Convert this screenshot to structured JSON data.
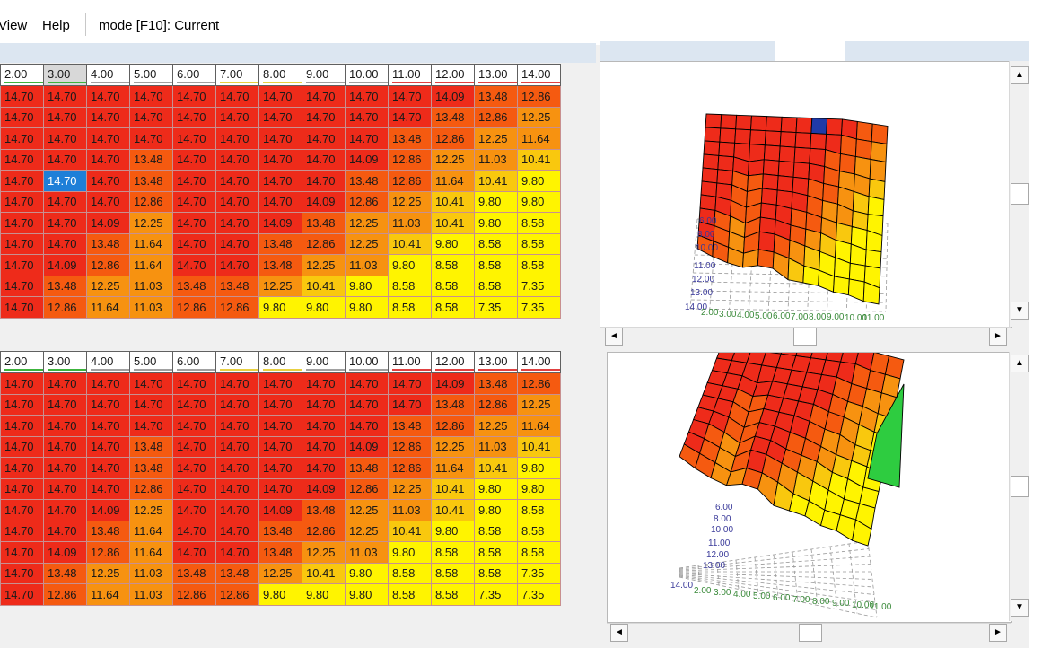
{
  "menu": {
    "view_label": "iew",
    "view_prefix": "V",
    "help_label": "elp",
    "help_prefix": "H",
    "mode_text": "mode [F10]: Current"
  },
  "colors": {
    "red": "#ee2b1a",
    "orange_red": "#f55a10",
    "orange": "#f79210",
    "orange_yellow": "#f9c80e",
    "yellow": "#fff400",
    "selection": "#1e7fd8"
  },
  "table_top": {
    "headers": [
      "2.00",
      "3.00",
      "4.00",
      "5.00",
      "6.00",
      "7.00",
      "8.00",
      "9.00",
      "10.00",
      "11.00",
      "12.00",
      "13.00",
      "14.00"
    ],
    "rows": [
      [
        "14.70",
        "14.70",
        "14.70",
        "14.70",
        "14.70",
        "14.70",
        "14.70",
        "14.70",
        "14.70",
        "14.70",
        "14.09",
        "13.48",
        "12.86"
      ],
      [
        "14.70",
        "14.70",
        "14.70",
        "14.70",
        "14.70",
        "14.70",
        "14.70",
        "14.70",
        "14.70",
        "14.70",
        "13.48",
        "12.86",
        "12.25"
      ],
      [
        "14.70",
        "14.70",
        "14.70",
        "14.70",
        "14.70",
        "14.70",
        "14.70",
        "14.70",
        "14.70",
        "13.48",
        "12.86",
        "12.25",
        "11.64"
      ],
      [
        "14.70",
        "14.70",
        "14.70",
        "13.48",
        "14.70",
        "14.70",
        "14.70",
        "14.70",
        "14.09",
        "12.86",
        "12.25",
        "11.03",
        "10.41"
      ],
      [
        "14.70",
        "14.70",
        "14.70",
        "13.48",
        "14.70",
        "14.70",
        "14.70",
        "14.70",
        "13.48",
        "12.86",
        "11.64",
        "10.41",
        "9.80"
      ],
      [
        "14.70",
        "14.70",
        "14.70",
        "12.86",
        "14.70",
        "14.70",
        "14.70",
        "14.09",
        "12.86",
        "12.25",
        "10.41",
        "9.80",
        "9.80"
      ],
      [
        "14.70",
        "14.70",
        "14.09",
        "12.25",
        "14.70",
        "14.70",
        "14.09",
        "13.48",
        "12.25",
        "11.03",
        "10.41",
        "9.80",
        "8.58"
      ],
      [
        "14.70",
        "14.70",
        "13.48",
        "11.64",
        "14.70",
        "14.70",
        "13.48",
        "12.86",
        "12.25",
        "10.41",
        "9.80",
        "8.58",
        "8.58"
      ],
      [
        "14.70",
        "14.09",
        "12.86",
        "11.64",
        "14.70",
        "14.70",
        "13.48",
        "12.25",
        "11.03",
        "9.80",
        "8.58",
        "8.58",
        "8.58"
      ],
      [
        "14.70",
        "13.48",
        "12.25",
        "11.03",
        "13.48",
        "13.48",
        "12.25",
        "10.41",
        "9.80",
        "8.58",
        "8.58",
        "8.58",
        "7.35"
      ],
      [
        "14.70",
        "12.86",
        "11.64",
        "11.03",
        "12.86",
        "12.86",
        "9.80",
        "9.80",
        "9.80",
        "8.58",
        "8.58",
        "7.35",
        "7.35"
      ]
    ],
    "selected_row": 4,
    "selected_col": 1
  },
  "table_bottom": {
    "headers": [
      "2.00",
      "3.00",
      "4.00",
      "5.00",
      "6.00",
      "7.00",
      "8.00",
      "9.00",
      "10.00",
      "11.00",
      "12.00",
      "13.00",
      "14.00"
    ],
    "rows": [
      [
        "14.70",
        "14.70",
        "14.70",
        "14.70",
        "14.70",
        "14.70",
        "14.70",
        "14.70",
        "14.70",
        "14.70",
        "14.09",
        "13.48",
        "12.86"
      ],
      [
        "14.70",
        "14.70",
        "14.70",
        "14.70",
        "14.70",
        "14.70",
        "14.70",
        "14.70",
        "14.70",
        "14.70",
        "13.48",
        "12.86",
        "12.25"
      ],
      [
        "14.70",
        "14.70",
        "14.70",
        "14.70",
        "14.70",
        "14.70",
        "14.70",
        "14.70",
        "14.70",
        "13.48",
        "12.86",
        "12.25",
        "11.64"
      ],
      [
        "14.70",
        "14.70",
        "14.70",
        "13.48",
        "14.70",
        "14.70",
        "14.70",
        "14.70",
        "14.09",
        "12.86",
        "12.25",
        "11.03",
        "10.41"
      ],
      [
        "14.70",
        "14.70",
        "14.70",
        "13.48",
        "14.70",
        "14.70",
        "14.70",
        "14.70",
        "13.48",
        "12.86",
        "11.64",
        "10.41",
        "9.80"
      ],
      [
        "14.70",
        "14.70",
        "14.70",
        "12.86",
        "14.70",
        "14.70",
        "14.70",
        "14.09",
        "12.86",
        "12.25",
        "10.41",
        "9.80",
        "9.80"
      ],
      [
        "14.70",
        "14.70",
        "14.09",
        "12.25",
        "14.70",
        "14.70",
        "14.09",
        "13.48",
        "12.25",
        "11.03",
        "10.41",
        "9.80",
        "8.58"
      ],
      [
        "14.70",
        "14.70",
        "13.48",
        "11.64",
        "14.70",
        "14.70",
        "13.48",
        "12.86",
        "12.25",
        "10.41",
        "9.80",
        "8.58",
        "8.58"
      ],
      [
        "14.70",
        "14.09",
        "12.86",
        "11.64",
        "14.70",
        "14.70",
        "13.48",
        "12.25",
        "11.03",
        "9.80",
        "8.58",
        "8.58",
        "8.58"
      ],
      [
        "14.70",
        "13.48",
        "12.25",
        "11.03",
        "13.48",
        "13.48",
        "12.25",
        "10.41",
        "9.80",
        "8.58",
        "8.58",
        "8.58",
        "7.35"
      ],
      [
        "14.70",
        "12.86",
        "11.64",
        "11.03",
        "12.86",
        "12.86",
        "9.80",
        "9.80",
        "9.80",
        "8.58",
        "8.58",
        "7.35",
        "7.35"
      ]
    ]
  },
  "plot_top": {
    "axis_y_labels": [
      "6.00",
      "8.00",
      "10.00",
      "11.00",
      "12.00",
      "13.00",
      "14.00"
    ],
    "axis_x_labels": [
      "2.00",
      "3.00",
      "4.00",
      "5.00",
      "6.00",
      "7.00",
      "8.00",
      "9.00",
      "10.00",
      "11.00"
    ],
    "scroll_up_glyph": "▲",
    "scroll_down_glyph": "▼",
    "scroll_left_glyph": "◄",
    "scroll_right_glyph": "►"
  },
  "plot_bottom": {
    "axis_y_labels": [
      "6.00",
      "8.00",
      "10.00",
      "11.00",
      "12.00",
      "13.00",
      "14.00"
    ],
    "axis_x_labels": [
      "2.00",
      "3.00",
      "4.00",
      "5.00",
      "6.00",
      "7.00",
      "8.00",
      "9.00",
      "10.00",
      "11.00"
    ],
    "scroll_up_glyph": "▲",
    "scroll_down_glyph": "▼",
    "scroll_left_glyph": "◄",
    "scroll_right_glyph": "►"
  }
}
